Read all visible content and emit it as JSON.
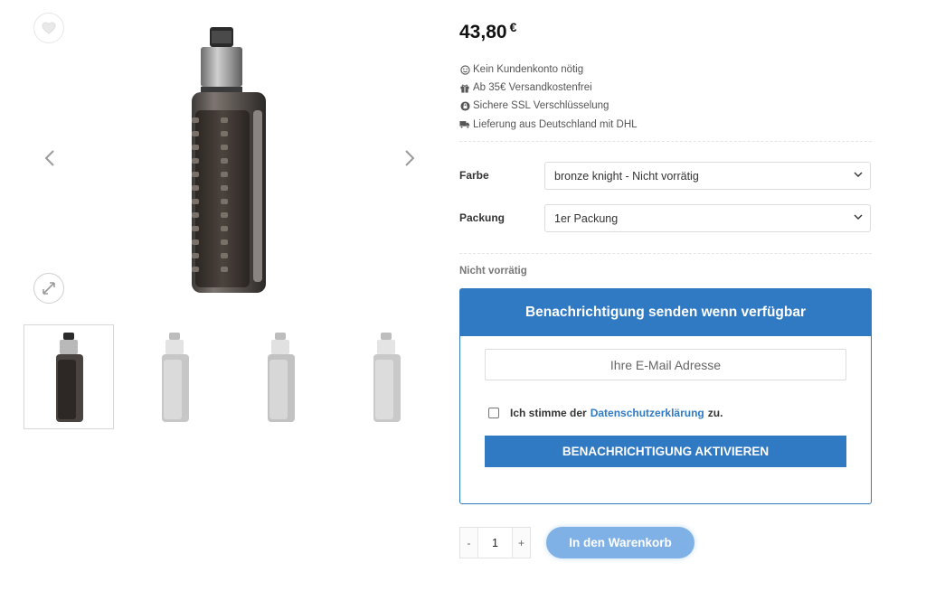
{
  "product": {
    "price": "43,80",
    "currency": "€",
    "features": [
      {
        "icon": "smile-icon",
        "text": "Kein Kundenkonto nötig"
      },
      {
        "icon": "gift-icon",
        "text": "Ab 35€ Versandkostenfrei"
      },
      {
        "icon": "lock-icon",
        "text": "Sichere SSL Verschlüsselung"
      },
      {
        "icon": "truck-icon",
        "text": "Lieferung aus Deutschland mit DHL"
      }
    ]
  },
  "variations": {
    "farbe": {
      "label": "Farbe",
      "selected": "bronze knight - Nicht vorrätig"
    },
    "packung": {
      "label": "Packung",
      "selected": "1er Packung"
    }
  },
  "stock_status": "Nicht vorrätig",
  "notify": {
    "title": "Benachrichtigung senden wenn verfügbar",
    "email_placeholder": "Ihre E-Mail Adresse",
    "consent_prefix": "Ich stimme der",
    "consent_link": "Datenschutzerklärung",
    "consent_suffix": "zu.",
    "button": "BENACHRICHTIGUNG AKTIVIEREN"
  },
  "cart": {
    "minus": "-",
    "quantity": "1",
    "plus": "+",
    "button": "In den Warenkorb"
  },
  "colors": {
    "accent": "#3079c3",
    "cart_button": "#7fb1e6",
    "link": "#2f7ac4"
  }
}
